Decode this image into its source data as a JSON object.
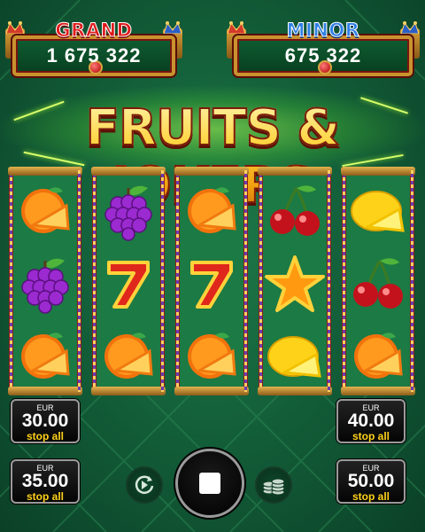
{
  "jackpots": {
    "grand": {
      "label": "GRAND",
      "value": "1 675 322"
    },
    "minor": {
      "label": "MINOR",
      "value": "675 322"
    }
  },
  "game_title": "FRUITS & JOKERS",
  "reels": [
    [
      "orange-icon",
      "grape-icon",
      "orange-icon"
    ],
    [
      "grape-icon",
      "seven-icon",
      "orange-icon"
    ],
    [
      "orange-icon",
      "seven-icon",
      "orange-icon"
    ],
    [
      "cherry-icon",
      "star-icon",
      "lemon-icon"
    ],
    [
      "lemon-icon",
      "cherry-icon",
      "orange-icon"
    ]
  ],
  "bets": {
    "left_top": {
      "currency": "EUR",
      "amount": "30.00",
      "action": "stop all"
    },
    "left_bottom": {
      "currency": "EUR",
      "amount": "35.00",
      "action": "stop all"
    },
    "right_top": {
      "currency": "EUR",
      "amount": "40.00",
      "action": "stop all"
    },
    "right_bottom": {
      "currency": "EUR",
      "amount": "50.00",
      "action": "stop all"
    }
  },
  "controls": {
    "autoplay_icon": "autoplay-icon",
    "stop_icon": "stop-icon",
    "coins_icon": "coins-icon"
  },
  "colors": {
    "background": "#13603a",
    "accent_gold": "#ffd23a",
    "reel_frame": "#8e1e18",
    "bet_action": "#ffd21a"
  }
}
